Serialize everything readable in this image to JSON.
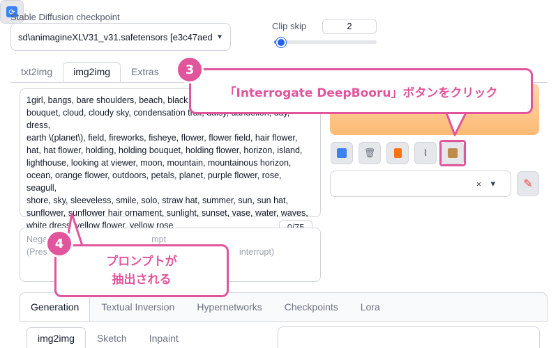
{
  "checkpoint": {
    "label": "Stable Diffusion checkpoint",
    "value": "sd\\animagineXLV31_v31.safetensors [e3c47aed",
    "refresh_icon": "refresh-icon"
  },
  "clip_skip": {
    "label": "Clip skip",
    "value": "2",
    "slider_fraction": 0.08
  },
  "tabs": [
    {
      "label": "txt2img",
      "active": false
    },
    {
      "label": "img2img",
      "active": true
    },
    {
      "label": "Extras",
      "active": false
    }
  ],
  "prompt": {
    "text": "1girl, bangs, bare shoulders, beach, black h... bouquet, cloud, cloudy sky, condensation trail, daisy, dandelion, day, dress, earth \\(planet\\), field, fireworks, fisheye, flower, flower field, hair flower, hat, hat flower, holding, holding bouquet, holding flower, horizon, island, lighthouse, looking at viewer, moon, mountain, mountainous horizon, ocean, orange flower, outdoors, petals, planet, purple flower, rose, seagull, shore, sky, sleeveless, smile, solo, straw hat, summer, sun, sun hat, sunflower, sunflower hair ornament, sunlight, sunset, vase, water, waves, white dress, yellow flower, yellow rose",
    "line1": "1girl, bangs, bare shoulders, beach, black h",
    "line2": "bouquet, cloud, cloudy sky, condensation trail, daisy, dandelion, day, dress,",
    "line3": "earth \\(planet\\), field, fireworks, fisheye, flower, flower field, hair flower,",
    "line4": "hat, hat flower, holding, holding bouquet, holding flower, horizon, island,",
    "line5": "lighthouse, looking at viewer, moon, mountain, mountainous horizon,",
    "line6": "ocean, orange flower, outdoors, petals, planet, purple flower, rose, seagull,",
    "line7": "shore, sky, sleeveless, smile, solo, straw hat, summer, sun, sun hat,",
    "line8": "sunflower, sunflower hair ornament, sunlight, sunset, vase, water, waves,",
    "line9": "white dress, yellow flower, yellow rose"
  },
  "token_counter": "0/75",
  "negative_prompt": {
    "line1_visible": "Nega",
    "line1_tail": "mpt",
    "line2_visible": "(Pres",
    "line2_tail": "interrupt)"
  },
  "toolbar_icons": [
    "arrow-icon",
    "trash-icon",
    "clipboard-icon",
    "paperclip-icon",
    "deepbooru-box-icon"
  ],
  "styles": {
    "clear": "×",
    "caret": "▾"
  },
  "bottom_tabs": [
    {
      "label": "Generation",
      "active": true
    },
    {
      "label": "Textual Inversion",
      "active": false
    },
    {
      "label": "Hypernetworks",
      "active": false
    },
    {
      "label": "Checkpoints",
      "active": false
    },
    {
      "label": "Lora",
      "active": false
    }
  ],
  "sub_tabs": [
    {
      "label": "img2img",
      "active": true
    },
    {
      "label": "Sketch",
      "active": false
    },
    {
      "label": "Inpaint",
      "active": false
    }
  ],
  "callouts": {
    "step3_number": "3",
    "step3_text": "「Interrogate DeepBooru」ボタンをクリック",
    "step4_number": "4",
    "step4_line1": "プロンプトが",
    "step4_line2": "抽出される"
  },
  "colors": {
    "accent_pink": "#e0559c",
    "generate_orange": "#fdba74",
    "slider_blue": "#2563eb"
  }
}
